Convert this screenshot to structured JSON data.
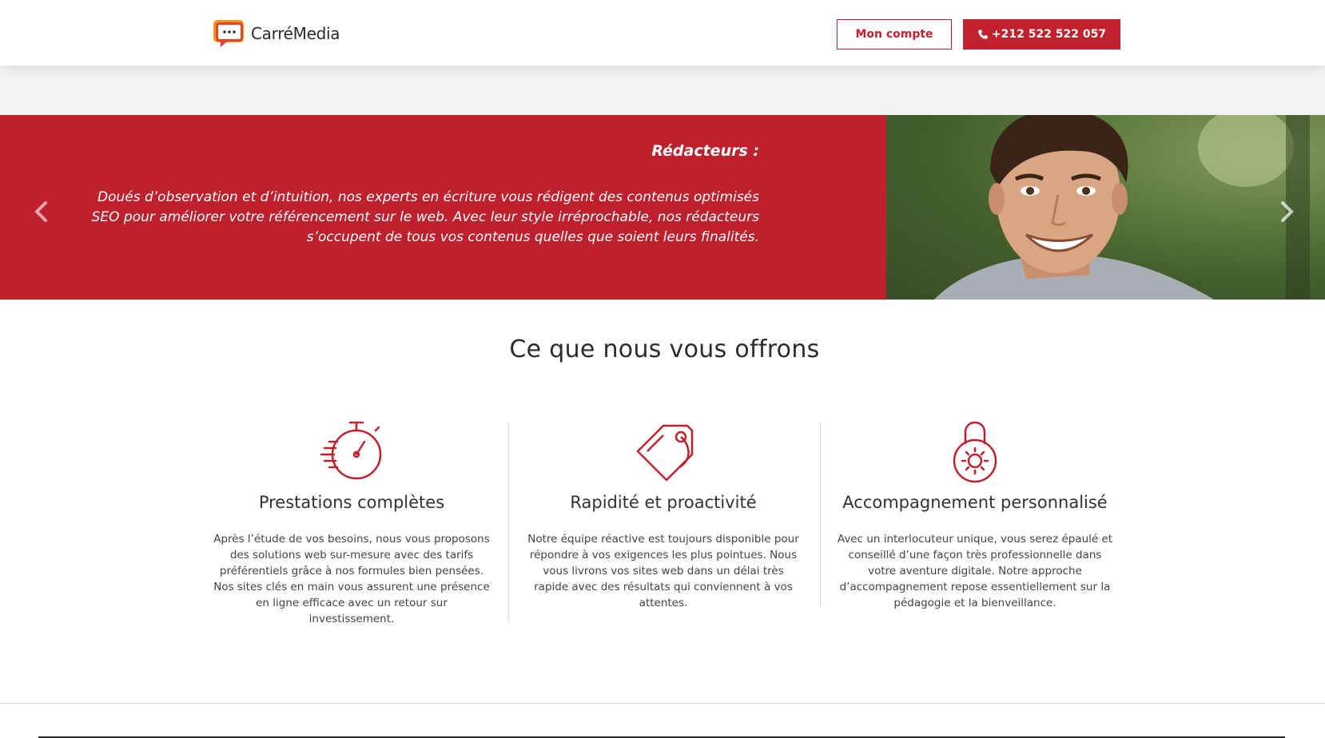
{
  "header": {
    "logo_text": "CarréMedia",
    "account_label": "Mon compte",
    "phone_label": "+212 522 522 057"
  },
  "slider": {
    "title": "Rédacteurs :",
    "text": "Doués d’observation et d’intuition, nos experts en écriture vous rédigent des contenus optimisés SEO pour améliorer votre référencement sur le web. Avec leur style irréprochable, nos rédacteurs s’occupent de tous vos contenus quelles que soient leurs finalités.",
    "prev_icon": "chevron-left-icon",
    "next_icon": "chevron-right-icon"
  },
  "offers": {
    "title": "Ce que nous vous offrons",
    "items": [
      {
        "icon": "stopwatch-icon",
        "title": "Prestations complètes",
        "text": "Après l’étude de vos besoins, nous vous proposons des solutions web sur-mesure avec des tarifs préférentiels grâce à nos formules bien pensées. Nos sites clés en main vous assurent une présence en ligne efficace avec un retour sur investissement."
      },
      {
        "icon": "price-tag-icon",
        "title": "Rapidité et proactivité",
        "text": "Notre équipe réactive est toujours disponible pour répondre à vos exigences les plus pointues. Nous vous livrons vos sites web dans un délai très rapide avec des résultats qui conviennent à vos attentes."
      },
      {
        "icon": "padlock-icon",
        "title": "Accompagnement personnalisé",
        "text": "Avec un interlocuteur unique, vous serez épaulé et conseillé d’une façon très professionnelle dans votre aventure digitale. Notre approche d’accompagnement repose essentiellement sur la pédagogie et la bienveillance."
      }
    ]
  },
  "colors": {
    "brand_red": "#be202e",
    "text_dark": "#333333"
  }
}
